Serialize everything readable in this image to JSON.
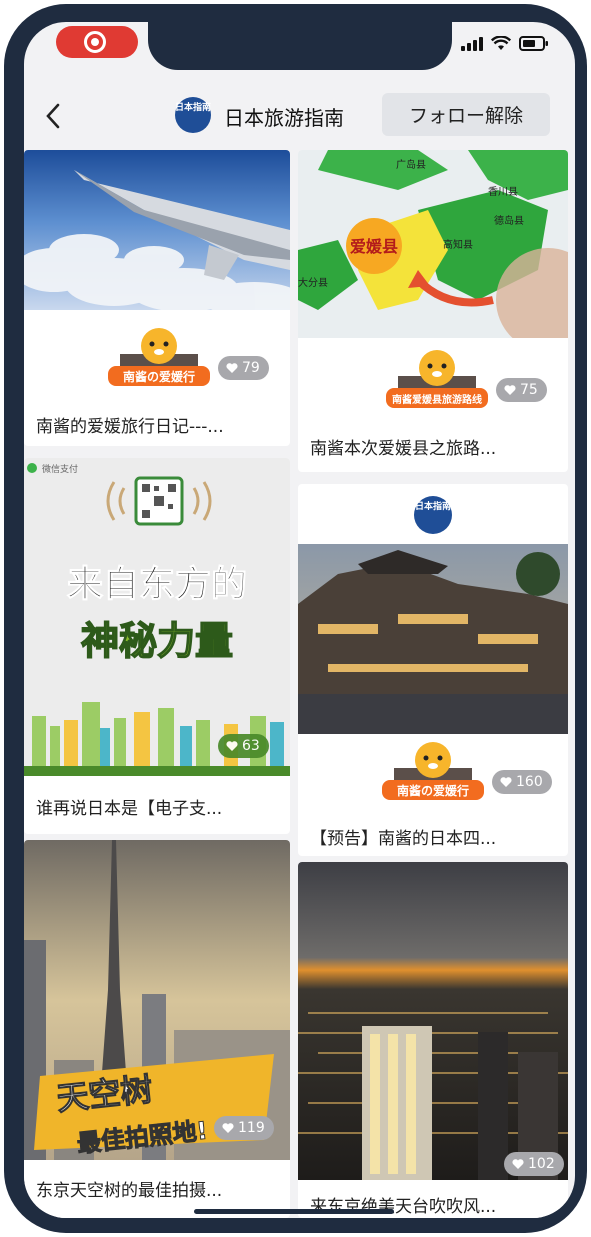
{
  "status_bar": {
    "record_icon": "screen-record-icon",
    "signal_icon": "signal-icon",
    "wifi_icon": "wifi-icon",
    "battery_icon": "battery-icon"
  },
  "header": {
    "back_icon": "chevron-left-icon",
    "channel_logo_text": "日本指南",
    "title": "日本旅游指南",
    "unfollow_label": "フォロー解除"
  },
  "cards": [
    {
      "title": "南酱的爱媛旅行日记---...",
      "likes": "79",
      "banner": "南酱の爱媛行",
      "image": "airplane-wing-clouds"
    },
    {
      "title": "南酱本次爱媛县之旅路...",
      "likes": "75",
      "banner": "南酱爱媛县旅游路线",
      "image": "ehime-map",
      "map_labels": [
        "广岛县",
        "香川县",
        "德岛县",
        "高知县",
        "大分县",
        "爱媛县"
      ]
    },
    {
      "title": "谁再说日本是【电子支...",
      "likes": "63",
      "image": "mobile-payment-poster",
      "poster_top": "微信支付",
      "poster_line1": "来自东方的",
      "poster_line2": "神秘力量"
    },
    {
      "title": "【预告】南酱的日本四...",
      "likes": "160",
      "banner": "南酱の爱媛行",
      "image": "dogo-onsen",
      "logo_text": "日本指南"
    },
    {
      "title": "东京天空树的最佳拍摄...",
      "likes": "119",
      "image": "tokyo-skytree",
      "poster_line1": "天空树",
      "poster_line2": "最佳拍照地!"
    },
    {
      "title": "来东京绝美天台吹吹风...",
      "likes": "102",
      "image": "tokyo-night-view"
    }
  ],
  "colors": {
    "frame": "#1f2c40",
    "accent_red": "#e03a33",
    "badge_gray": "#a8a8ac",
    "logo_blue": "#1f4e97"
  }
}
